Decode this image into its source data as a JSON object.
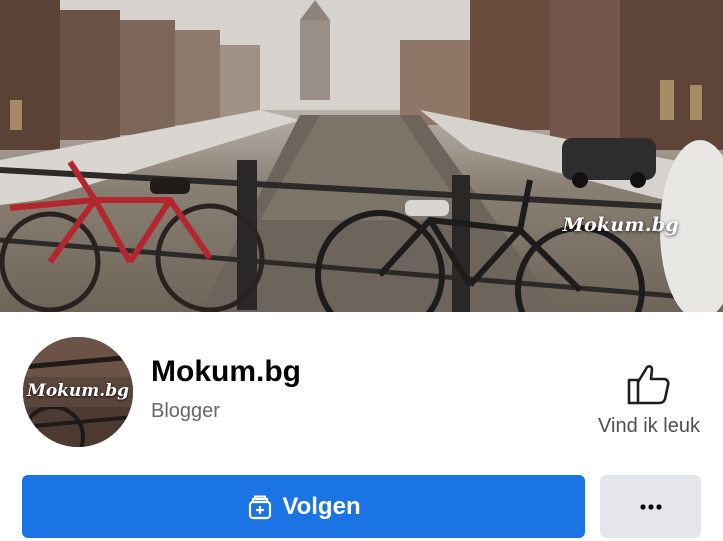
{
  "cover": {
    "watermark": "Mokum.bg"
  },
  "profile": {
    "avatar_watermark": "Mokum.bg",
    "name": "Mokum.bg",
    "category": "Blogger"
  },
  "actions": {
    "like_label": "Vind ik leuk",
    "follow_label": "Volgen",
    "more_icon": "ellipsis-icon"
  },
  "colors": {
    "primary": "#1b74e4",
    "secondary_button": "#e4e6eb",
    "text_primary": "#050505",
    "text_secondary": "#65676b"
  }
}
